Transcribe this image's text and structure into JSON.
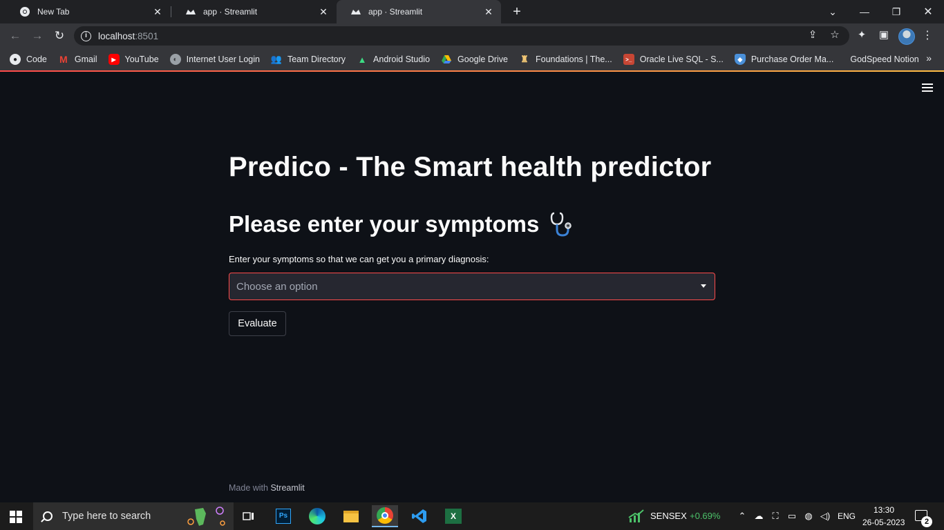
{
  "browser": {
    "tabs": [
      {
        "title": "New Tab",
        "icon": "chrome-icon"
      },
      {
        "title": "app · Streamlit",
        "icon": "streamlit-icon"
      },
      {
        "title": "app · Streamlit",
        "icon": "streamlit-icon",
        "active": true
      }
    ],
    "url_host": "localhost",
    "url_port": ":8501",
    "bookmarks": [
      {
        "label": "Code",
        "icon": "github-icon"
      },
      {
        "label": "Gmail",
        "icon": "gmail-icon"
      },
      {
        "label": "YouTube",
        "icon": "youtube-icon"
      },
      {
        "label": "Internet User Login",
        "icon": "globe-icon"
      },
      {
        "label": "Team Directory",
        "icon": "people-icon"
      },
      {
        "label": "Android Studio",
        "icon": "android-icon"
      },
      {
        "label": "Google Drive",
        "icon": "drive-icon"
      },
      {
        "label": "Foundations | The...",
        "icon": "foundations-icon"
      },
      {
        "label": "Oracle Live SQL - S...",
        "icon": "terminal-icon"
      },
      {
        "label": "Purchase Order Ma...",
        "icon": "shield-icon"
      },
      {
        "label": "GodSpeed Notion",
        "icon": ""
      }
    ]
  },
  "app": {
    "title": "Predico - The Smart health predictor",
    "subtitle": "Please enter your symptoms",
    "input_label": "Enter your symptoms so that we can get you a primary diagnosis:",
    "select_placeholder": "Choose an option",
    "evaluate_label": "Evaluate",
    "footer_prefix": "Made with",
    "footer_brand": "Streamlit"
  },
  "taskbar": {
    "search_placeholder": "Type here to search",
    "stock_name": "SENSEX",
    "stock_change": "+0.69%",
    "language": "ENG",
    "time": "13:30",
    "date": "26-05-2023",
    "notification_count": "2"
  },
  "colors": {
    "page_bg": "#0e1117",
    "accent": "#ff4b4b",
    "stock_up": "#4cc26a"
  }
}
